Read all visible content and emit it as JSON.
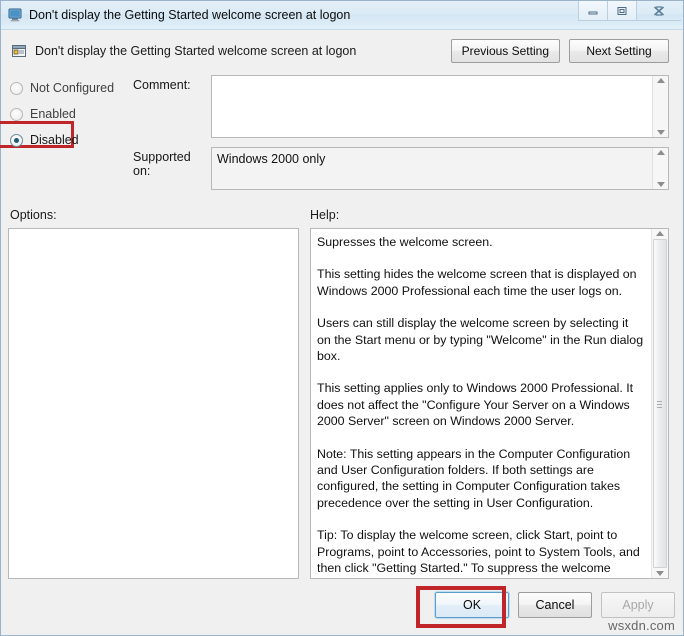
{
  "window": {
    "title": "Don't display the Getting Started welcome screen at logon",
    "title_icon": "computer-icon",
    "controls": {
      "minimize": "minimize-icon",
      "restore": "restore-icon",
      "close": "close-icon"
    }
  },
  "setting_header": {
    "icon": "policy-setting-icon",
    "title": "Don't display the Getting Started welcome screen at logon",
    "previous_button": "Previous Setting",
    "next_button": "Next Setting"
  },
  "state": {
    "options": [
      {
        "label": "Not Configured",
        "selected": false
      },
      {
        "label": "Enabled",
        "selected": false
      },
      {
        "label": "Disabled",
        "selected": true
      }
    ],
    "selected": "Disabled"
  },
  "comment": {
    "label": "Comment:",
    "value": "",
    "placeholder": ""
  },
  "supported_on": {
    "label": "Supported on:",
    "value": "Windows 2000 only"
  },
  "panels": {
    "options_label": "Options:",
    "help_label": "Help:",
    "options_content": ""
  },
  "help": {
    "paragraphs": [
      "Supresses the welcome screen.",
      "This setting hides the welcome screen that is displayed on Windows 2000 Professional each time the user logs on.",
      "Users can still display the welcome screen by selecting it on the Start menu or by typing \"Welcome\" in the Run dialog box.",
      "This setting applies only to Windows 2000 Professional. It does not affect the \"Configure Your Server on a Windows 2000 Server\" screen on Windows 2000 Server.",
      "Note: This setting appears in the Computer Configuration and User Configuration folders. If both settings are configured, the setting in Computer Configuration takes precedence over the setting in User Configuration.",
      "Tip: To display the welcome screen, click Start, point to Programs, point to Accessories, point to System Tools, and then click \"Getting Started.\" To suppress the welcome screen without specifying a setting, clear the \"Show this screen at startup\" check"
    ]
  },
  "footer": {
    "ok": "OK",
    "cancel": "Cancel",
    "apply": "Apply",
    "apply_disabled": true
  },
  "annotations": {
    "highlight_color": "#c0252a",
    "highlighted_items": [
      "Disabled",
      "OK"
    ]
  },
  "watermark": "wsxdn.com"
}
